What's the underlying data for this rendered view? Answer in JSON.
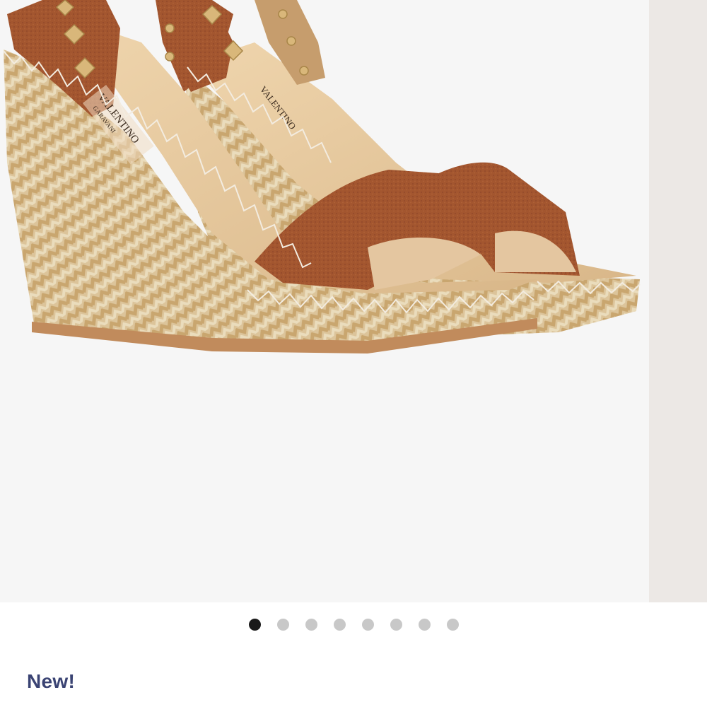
{
  "product": {
    "image_alt": "Rockstud espadrille wedge sandals in tan leather with woven jute wedge",
    "brand_insole_text": "VALENTINO",
    "brand_insole_subtext": "GARAVANI"
  },
  "carousel": {
    "slide_count": 8,
    "active_index": 0,
    "dots": [
      "1",
      "2",
      "3",
      "4",
      "5",
      "6",
      "7",
      "8"
    ]
  },
  "badge": {
    "new_label": "New!"
  },
  "colors": {
    "leather": "#a3562f",
    "leather_dark": "#7e3c1d",
    "jute_light": "#e6d3ad",
    "jute_dark": "#c8a46e",
    "stitch": "#f3ece0",
    "stud": "#d9b77a",
    "insole": "#e1c49b",
    "label_blue": "#3a4373",
    "dot_active": "#1a1a1a",
    "dot_inactive": "#c8c8c8"
  }
}
